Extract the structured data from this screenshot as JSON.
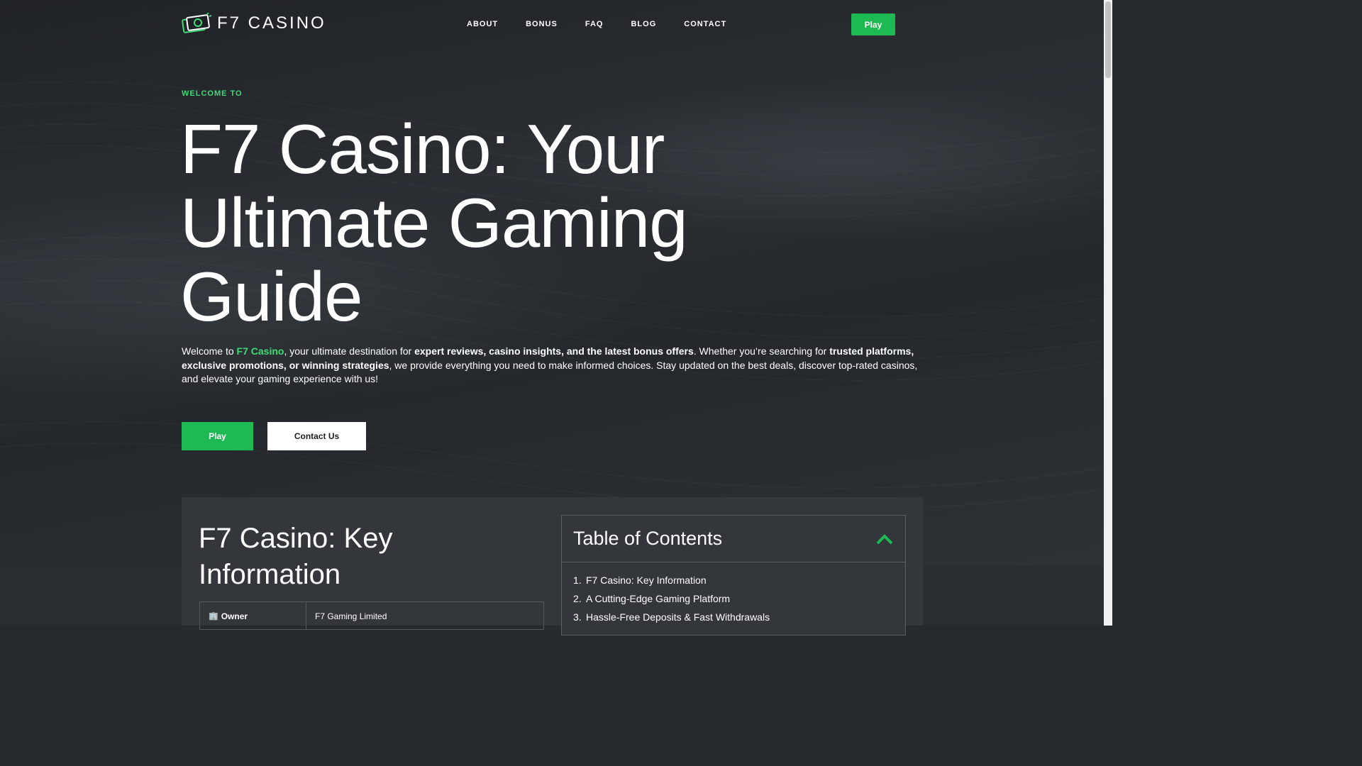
{
  "header": {
    "logo_text": "F7 CASINO",
    "nav": [
      "ABOUT",
      "BONUS",
      "FAQ",
      "BLOG",
      "CONTACT"
    ],
    "play_label": "Play"
  },
  "hero": {
    "eyebrow": "WELCOME TO",
    "title": "F7 Casino: Your Ultimate Gaming Guide",
    "intro": {
      "p1": "Welcome to ",
      "brand": "F7 Casino",
      "p2": ", your ultimate destination for ",
      "b1": "expert reviews, casino insights, and the latest bonus offers",
      "p3": ". Whether you’re searching for ",
      "b2": "trusted platforms, exclusive promotions, or winning strategies",
      "p4": ", we provide everything you need to make informed choices. Stay updated on the best deals, discover top-rated casinos, and elevate your gaming experience with us!"
    },
    "play_label": "Play",
    "contact_label": "Contact Us"
  },
  "key_info": {
    "title": "F7 Casino: Key Information",
    "rows": [
      {
        "icon": "building-icon",
        "key": "Owner",
        "value": "F7 Gaming Limited"
      }
    ]
  },
  "toc": {
    "title": "Table of Contents",
    "items": [
      {
        "num": "1.",
        "label": "F7 Casino: Key Information"
      },
      {
        "num": "2.",
        "label": "A Cutting-Edge Gaming Platform"
      },
      {
        "num": "3.",
        "label": "Hassle-Free Deposits & Fast Withdrawals"
      }
    ]
  },
  "colors": {
    "accent": "#1fb954",
    "accent_text": "#3ddc75",
    "background": "#262a2e",
    "card": "#33373c"
  }
}
